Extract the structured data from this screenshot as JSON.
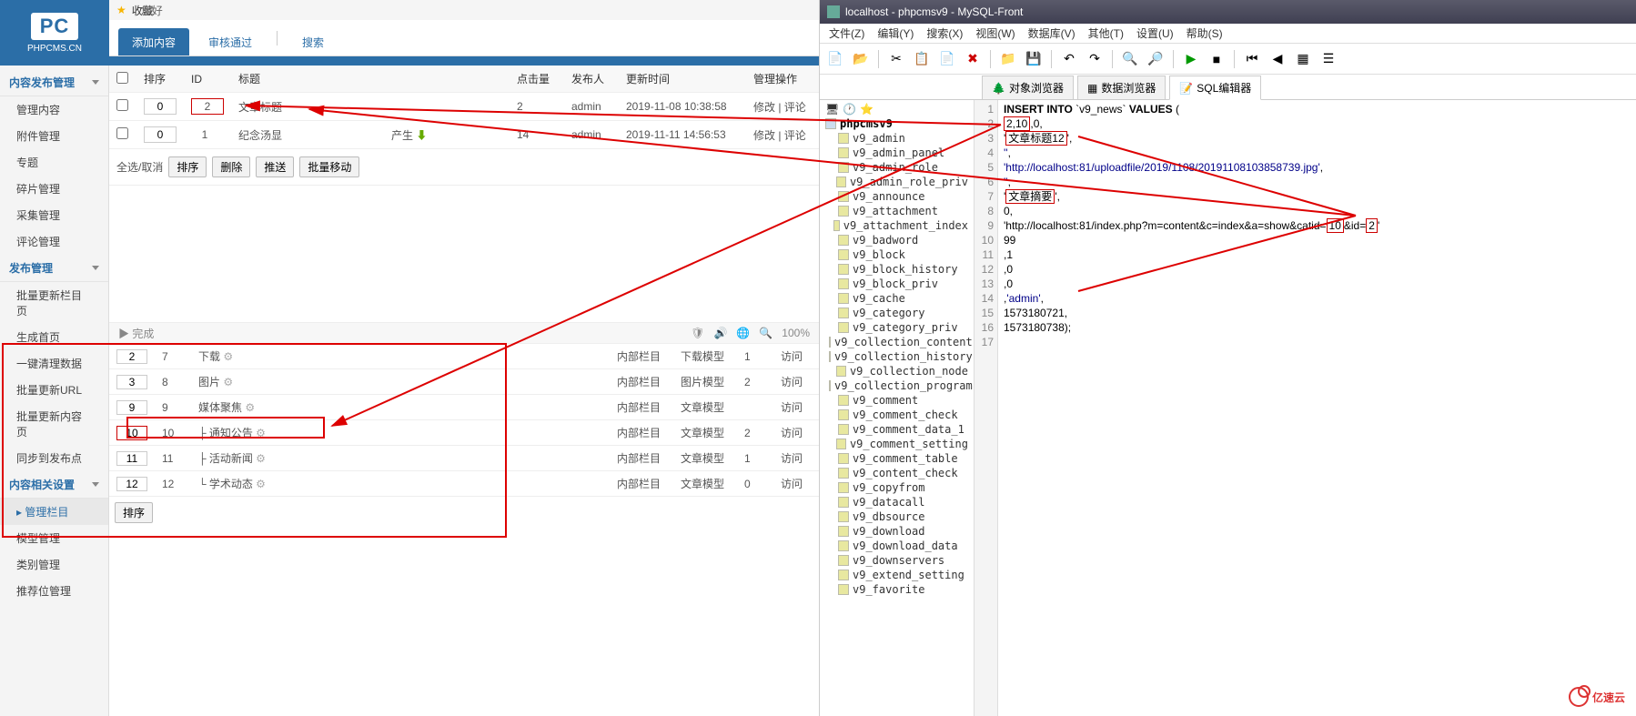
{
  "cms": {
    "logo_big": "PC",
    "logo_sub": "PHPCMS.CN",
    "fav_label": "收藏",
    "header_greeting": "您好",
    "tabs": {
      "add": "添加内容",
      "approve": "审核通过",
      "search": "搜索"
    },
    "sidebar": {
      "g1": {
        "title": "内容发布管理",
        "items": [
          "管理内容",
          "附件管理",
          "专题",
          "碎片管理",
          "采集管理",
          "评论管理"
        ]
      },
      "g2": {
        "title": "发布管理",
        "items": [
          "批量更新栏目页",
          "生成首页",
          "一键清理数据",
          "批量更新URL",
          "批量更新内容页",
          "同步到发布点"
        ]
      },
      "g3": {
        "title": "内容相关设置",
        "items": [
          "管理栏目",
          "模型管理",
          "类别管理",
          "推荐位管理"
        ]
      }
    },
    "table": {
      "headers": {
        "chk": "",
        "sort": "排序",
        "id": "ID",
        "title": "标题",
        "hits": "点击量",
        "author": "发布人",
        "time": "更新时间",
        "ops": "管理操作"
      },
      "rows": [
        {
          "sort": "0",
          "id": "2",
          "title": "文章标题",
          "hits": "2",
          "author": "admin",
          "time": "2019-11-08 10:38:58",
          "ops": "修改 | 评论",
          "boxed": true
        },
        {
          "sort": "0",
          "id": "1",
          "title": "纪念汤显",
          "title_suffix": "产生",
          "hits": "14",
          "author": "admin",
          "time": "2019-11-11 14:56:53",
          "ops": "修改 | 评论"
        }
      ],
      "bulk": {
        "select_all": "全选/取消",
        "sort": "排序",
        "delete": "删除",
        "push": "推送",
        "move": "批量移动"
      }
    },
    "status": {
      "done": "完成",
      "zoom": "100%"
    },
    "cat_table": {
      "cols": {
        "pos": "内部栏目",
        "model": "",
        "count": "",
        "act": "访问"
      },
      "rows": [
        {
          "n": "2",
          "id": "7",
          "name": "下载",
          "pos": "内部栏目",
          "model": "下载模型",
          "count": "1",
          "act": "访问"
        },
        {
          "n": "3",
          "id": "8",
          "name": "图片",
          "pos": "内部栏目",
          "model": "图片模型",
          "count": "2",
          "act": "访问"
        },
        {
          "n": "9",
          "id": "9",
          "name": "媒体聚焦",
          "pos": "内部栏目",
          "model": "文章模型",
          "count": "",
          "act": "访问"
        },
        {
          "n": "10",
          "id": "10",
          "name": "├ 通知公告",
          "pos": "内部栏目",
          "model": "文章模型",
          "count": "2",
          "act": "访问",
          "boxed": true
        },
        {
          "n": "11",
          "id": "11",
          "name": "├ 活动新闻",
          "pos": "内部栏目",
          "model": "文章模型",
          "count": "1",
          "act": "访问"
        },
        {
          "n": "12",
          "id": "12",
          "name": "└ 学术动态",
          "pos": "内部栏目",
          "model": "文章模型",
          "count": "0",
          "act": "访问"
        }
      ],
      "sort_btn": "排序"
    }
  },
  "db": {
    "title": "localhost - phpcmsv9 - MySQL-Front",
    "menus": [
      "文件(Z)",
      "编辑(Y)",
      "搜索(X)",
      "视图(W)",
      "数据库(V)",
      "其他(T)",
      "设置(U)",
      "帮助(S)"
    ],
    "tabs": {
      "obj": "对象浏览器",
      "data": "数据浏览器",
      "sql": "SQL编辑器"
    },
    "tree_root": "phpcmsv9",
    "tree": [
      "v9_admin",
      "v9_admin_panel",
      "v9_admin_role",
      "v9_admin_role_priv",
      "v9_announce",
      "v9_attachment",
      "v9_attachment_index",
      "v9_badword",
      "v9_block",
      "v9_block_history",
      "v9_block_priv",
      "v9_cache",
      "v9_category",
      "v9_category_priv",
      "v9_collection_content",
      "v9_collection_history",
      "v9_collection_node",
      "v9_collection_program",
      "v9_comment",
      "v9_comment_check",
      "v9_comment_data_1",
      "v9_comment_setting",
      "v9_comment_table",
      "v9_content_check",
      "v9_copyfrom",
      "v9_datacall",
      "v9_dbsource",
      "v9_download",
      "v9_download_data",
      "v9_downservers",
      "v9_extend_setting",
      "v9_favorite"
    ],
    "sql_lines": [
      "INSERT INTO `v9_news` VALUES (",
      "2,10,0,",
      "'文章标题12',",
      "'',",
      "'http://localhost:81/uploadfile/2019/1108/20191108103858739.jpg',",
      "'',",
      "'文章摘要',",
      "0,",
      "'http://localhost:81/index.php?m=content&c=index&a=show&catid=10&id=2'",
      "99",
      ",1",
      ",0",
      ",0",
      ",'admin',",
      "1573180721,",
      "1573180738);",
      ""
    ],
    "gutter": [
      "1",
      "2",
      "3",
      "4",
      "5",
      "6",
      "7",
      "8",
      "9",
      "10",
      "11",
      "12",
      "13",
      "14",
      "15",
      "16",
      "17"
    ]
  },
  "yisu": "亿速云"
}
